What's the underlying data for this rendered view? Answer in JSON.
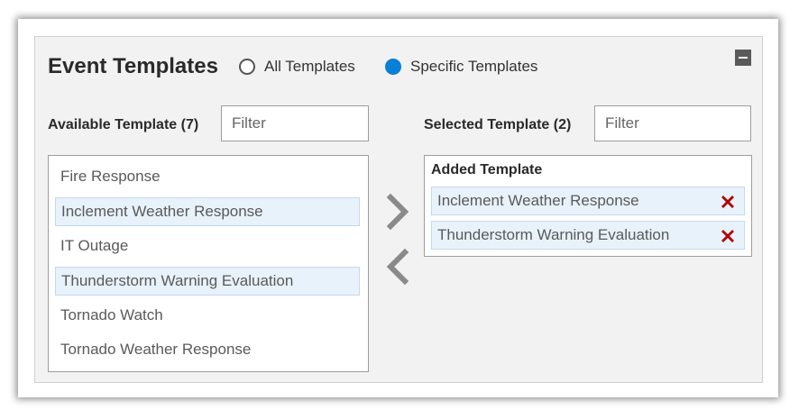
{
  "header": {
    "title": "Event Templates",
    "radio_all": "All Templates",
    "radio_specific": "Specific Templates",
    "selected_option": "Specific Templates"
  },
  "available": {
    "label": "Available Template (7)",
    "filter_placeholder": "Filter",
    "items": [
      {
        "label": "Fire Response",
        "selected": false
      },
      {
        "label": "Inclement Weather Response",
        "selected": true
      },
      {
        "label": "IT Outage",
        "selected": false
      },
      {
        "label": "Thunderstorm Warning Evaluation",
        "selected": true
      },
      {
        "label": "Tornado Watch",
        "selected": false
      },
      {
        "label": "Tornado Weather Response",
        "selected": false
      }
    ]
  },
  "selected": {
    "label": "Selected Template (2)",
    "filter_placeholder": "Filter",
    "group_title": "Added Template",
    "items": [
      {
        "label": "Inclement Weather Response"
      },
      {
        "label": "Thunderstorm Warning Evaluation"
      }
    ]
  },
  "icons": {
    "move_right": "chevron-right-icon",
    "move_left": "chevron-left-icon",
    "remove": "red-x-icon",
    "collapse": "minus-icon"
  },
  "colors": {
    "accent": "#0a7fd6",
    "remove": "#b00000",
    "selected_bg": "#e8f2fb"
  }
}
